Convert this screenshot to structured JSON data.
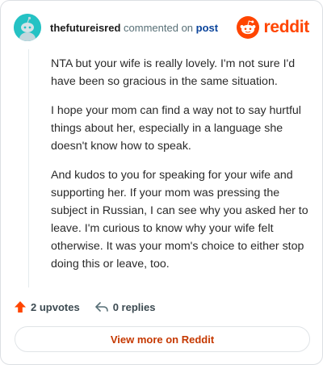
{
  "comment": {
    "username": "thefutureisred",
    "commented_on": "commented on",
    "post_link": "post",
    "paragraphs": [
      "NTA but your wife is really lovely. I'm not sure I'd have been so gracious in the same situation.",
      "I hope your mom can find a way not to say hurtful things about her, especially in a language she doesn't know how to speak.",
      "And kudos to you for speaking for your wife and supporting her. If your mom was pressing the subject in Russian, I can see why you asked her to leave. I'm curious to know why your wife felt otherwise. It was your mom's choice to either stop doing this or leave, too."
    ]
  },
  "brand": {
    "wordmark": "reddit",
    "color": "#ff4500"
  },
  "actions": {
    "upvotes": "2 upvotes",
    "replies": "0 replies"
  },
  "footer": {
    "view_more": "View more on Reddit"
  },
  "icons": {
    "avatar": "snoo-avatar-icon",
    "logo": "reddit-logo-icon",
    "upvote": "upvote-arrow-icon",
    "reply": "reply-arrow-icon"
  }
}
